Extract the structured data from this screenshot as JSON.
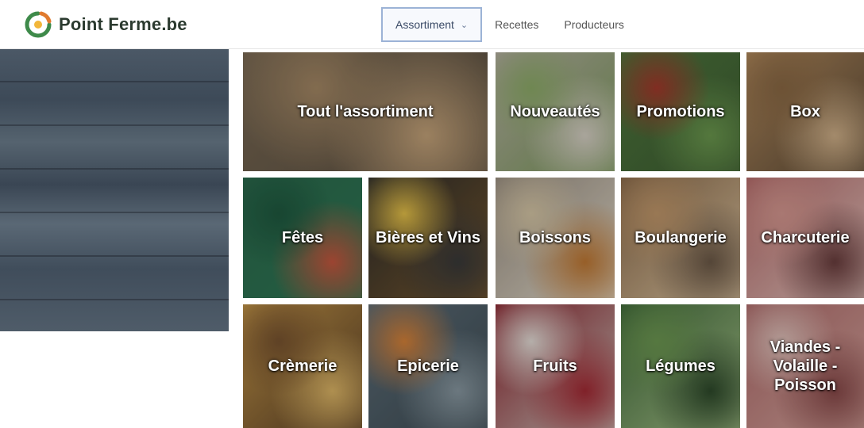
{
  "brand": {
    "name": "Point Ferme.be"
  },
  "nav": {
    "items": [
      {
        "label": "Assortiment",
        "has_dropdown": true,
        "active": true
      },
      {
        "label": "Recettes"
      },
      {
        "label": "Producteurs"
      }
    ]
  },
  "categories": [
    {
      "label": "Tout l'assortiment",
      "colors": [
        "#7a6a55",
        "#a78a66",
        "#c7a57b",
        "#5b4f40"
      ]
    },
    {
      "label": "Nouveautés",
      "colors": [
        "#b9b2a6",
        "#8fae6a",
        "#d9d3c7",
        "#7a9a5a"
      ]
    },
    {
      "label": "Promotions",
      "colors": [
        "#4f7a3e",
        "#a53a2c",
        "#6c9a4f",
        "#3f5e33"
      ]
    },
    {
      "label": "Box",
      "colors": [
        "#b58c5e",
        "#8c6a45",
        "#d2b28a",
        "#5c4a36"
      ]
    },
    {
      "label": "Fêtes",
      "colors": [
        "#2c6b4e",
        "#1f5a40",
        "#c8583f",
        "#2e7a55"
      ]
    },
    {
      "label": "Bières et Vins",
      "colors": [
        "#2b2b2b",
        "#e8c34a",
        "#3a3a3a",
        "#7a5a2e"
      ]
    },
    {
      "label": "Boissons",
      "colors": [
        "#9a8f82",
        "#d9c9a8",
        "#c27a34",
        "#e8e0cf"
      ]
    },
    {
      "label": "Boulangerie",
      "colors": [
        "#8a6a4a",
        "#c49a6c",
        "#6d5a48",
        "#e2c9a4"
      ]
    },
    {
      "label": "Charcuterie",
      "colors": [
        "#b66a6a",
        "#d99a92",
        "#6b3e3e",
        "#e6c7c0"
      ]
    },
    {
      "label": "Crèmerie",
      "colors": [
        "#c99a4a",
        "#7a5530",
        "#e0b867",
        "#5a3f26"
      ]
    },
    {
      "label": "Epicerie",
      "colors": [
        "#5e6f7a",
        "#d9843a",
        "#8a9aa3",
        "#3f4d55"
      ]
    },
    {
      "label": "Fruits",
      "colors": [
        "#8a1f2a",
        "#e8e0da",
        "#a52b35",
        "#cfc6be"
      ]
    },
    {
      "label": "Légumes",
      "colors": [
        "#3f6a3a",
        "#6e9a52",
        "#2e4a2b",
        "#a8c48a"
      ]
    },
    {
      "label": "Viandes - Volaille - Poisson",
      "colors": [
        "#b06a6a",
        "#e3c4bd",
        "#8a4a4a",
        "#d8a8a0"
      ]
    }
  ]
}
